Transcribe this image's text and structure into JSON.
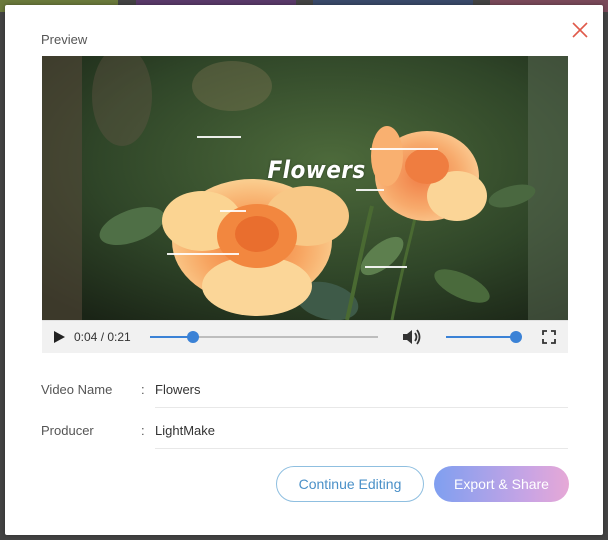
{
  "dialog": {
    "title": "Preview",
    "close_icon": "close-icon"
  },
  "video": {
    "overlay_title": "Flowers",
    "current_time": "0:04",
    "duration": "0:21",
    "time_display": "0:04 / 0:21",
    "progress_fraction": 0.19,
    "volume_fraction": 1.0,
    "icons": {
      "play": "play-icon",
      "volume": "volume-icon",
      "fullscreen": "fullscreen-icon"
    },
    "accent_color": "#3b82d6"
  },
  "info": {
    "video_name_label": "Video Name",
    "video_name_value": "Flowers",
    "producer_label": "Producer",
    "producer_value": "LightMake",
    "separator": ":"
  },
  "actions": {
    "continue_label": "Continue Editing",
    "export_label": "Export & Share"
  },
  "colors": {
    "close": "#e05a4a",
    "continue_border": "#8fbfe0",
    "export_gradient_start": "#7f9ff0",
    "export_gradient_end": "#e6a8d6"
  }
}
